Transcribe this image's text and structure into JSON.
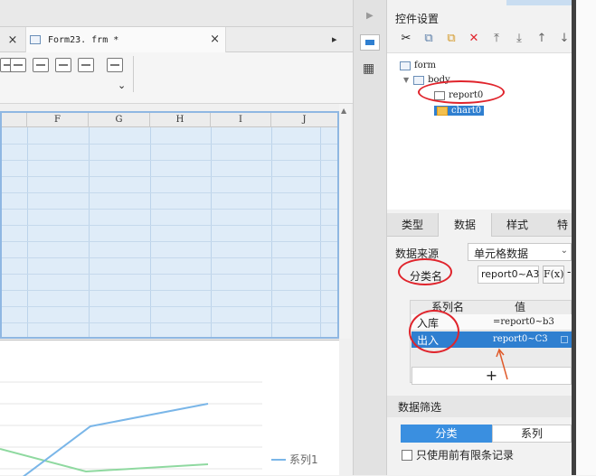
{
  "editor": {
    "tab_file": "Form23. frm *",
    "close_glyph": "×",
    "dropdown_glyph": "⌄",
    "pin_glyph": "▸"
  },
  "grid": {
    "columns": [
      "F",
      "G",
      "H",
      "I",
      "J"
    ]
  },
  "chart": {
    "legend_label": "系列1",
    "series_colors": [
      "#7ab6e8",
      "#8fd9a0"
    ]
  },
  "right_panel": {
    "title": "控件设置",
    "tools": [
      "✂",
      "⧉",
      "⧉",
      "✕",
      "⤒",
      "⤓",
      "↑",
      "↓"
    ],
    "tree": {
      "form": "form",
      "body": "body",
      "report": "report0",
      "chart": "chart0"
    },
    "tabs": [
      "类型",
      "数据",
      "样式",
      "特效"
    ],
    "data_source_label": "数据来源",
    "data_source_value": "单元格数据",
    "category_label": "分类名",
    "category_value": "report0~A3",
    "fx_label": "F(x)",
    "minus": "-",
    "series_header_name": "系列名",
    "series_header_value": "值",
    "series_rows": [
      {
        "name": "入库",
        "value": "=report0~b3"
      },
      {
        "name": "出入",
        "value": "report0~C3"
      }
    ],
    "add_glyph": "+",
    "filter_title": "数据筛选",
    "filter_buttons": [
      "分类",
      "系列"
    ],
    "limit_label": "只使用前有限条记录"
  },
  "colors": {
    "accent": "#2f7fd0",
    "annotation_red": "#e0242c",
    "arrow_orange": "#e05a2a"
  }
}
